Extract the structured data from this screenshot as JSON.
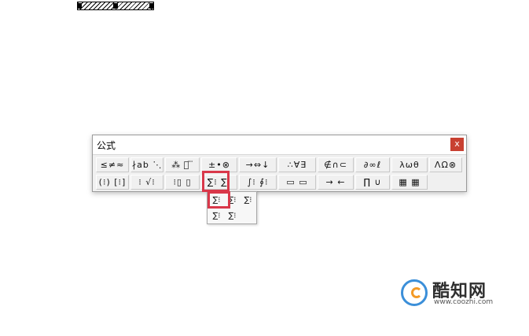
{
  "window": {
    "title": "公式",
    "close_label": "x"
  },
  "toolbar": {
    "row1": [
      {
        "name": "relations-palette-button",
        "label": "≤≠≈"
      },
      {
        "name": "spaces-ellipses-palette-button",
        "label": "∤ab ⋱"
      },
      {
        "name": "embellishments-palette-button",
        "label": "⁂ ⃞ ⃛"
      },
      {
        "name": "operators-palette-button",
        "label": "±•⊗"
      },
      {
        "name": "arrows-palette-button",
        "label": "→⇔↓"
      },
      {
        "name": "logic-palette-button",
        "label": "∴∀∃"
      },
      {
        "name": "set-theory-palette-button",
        "label": "∉∩⊂"
      },
      {
        "name": "misc-symbols-palette-button",
        "label": "∂∞ℓ"
      },
      {
        "name": "greek-lowercase-palette-button",
        "label": "λωθ"
      },
      {
        "name": "greek-uppercase-palette-button",
        "label": "ΛΩ⊗"
      }
    ],
    "row2": [
      {
        "name": "fences-palette-button",
        "label": "(⁝) [⁝]"
      },
      {
        "name": "fractions-radicals-palette-button",
        "label": "⁝ √⁝"
      },
      {
        "name": "subscript-superscript-palette-button",
        "label": "⁝▯ ▯"
      },
      {
        "name": "summation-palette-button",
        "label": "∑⁝ ∑⁝"
      },
      {
        "name": "integrals-palette-button",
        "label": "∫⁝ ∮⁝"
      },
      {
        "name": "underbar-overbar-palette-button",
        "label": "▭ ▭"
      },
      {
        "name": "labeled-arrows-palette-button",
        "label": "→ ←"
      },
      {
        "name": "products-palette-button",
        "label": "∏ ∪"
      },
      {
        "name": "matrices-palette-button",
        "label": "▦ ▦"
      }
    ]
  },
  "dropdown": {
    "row1": [
      {
        "name": "summation-template-1",
        "label": "∑⁝"
      },
      {
        "name": "summation-template-2",
        "label": "∑⁝"
      },
      {
        "name": "summation-template-3",
        "label": "∑⁝"
      }
    ],
    "row2": [
      {
        "name": "summation-template-4",
        "label": "∑⁝"
      },
      {
        "name": "summation-template-5",
        "label": "∑⁝"
      }
    ]
  },
  "watermark": {
    "name": "酷知网",
    "url": "www.coozhi.com"
  }
}
